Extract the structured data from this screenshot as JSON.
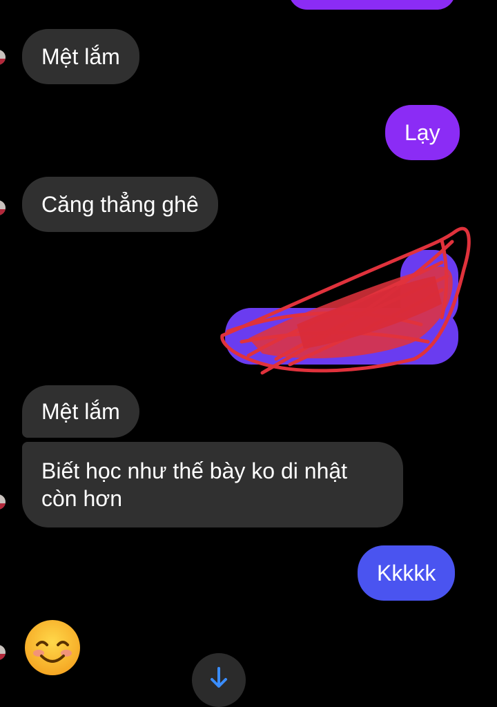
{
  "messages": [
    {
      "id": "m1",
      "direction": "outgoing",
      "text": ""
    },
    {
      "id": "m2",
      "direction": "incoming",
      "text": "Mệt lắm"
    },
    {
      "id": "m3",
      "direction": "outgoing",
      "text": "Lạy"
    },
    {
      "id": "m4",
      "direction": "incoming",
      "text": "Căng thẳng ghê"
    },
    {
      "id": "m5",
      "direction": "outgoing",
      "text": "",
      "redacted": true
    },
    {
      "id": "m6",
      "direction": "incoming",
      "text": "Mệt lắm"
    },
    {
      "id": "m7",
      "direction": "incoming",
      "text": "Biết học như thế bày ko di nhật còn hơn"
    },
    {
      "id": "m8",
      "direction": "outgoing",
      "text": "Kkkkk"
    },
    {
      "id": "m9",
      "direction": "incoming",
      "emoji": "smiling-face-with-smiling-eyes"
    }
  ],
  "colors": {
    "background": "#000000",
    "incoming_bubble": "#303030",
    "outgoing_purple": "#8b2cf5",
    "outgoing_violet": "#6a3cf0",
    "outgoing_blue": "#4a54f0",
    "scribble": "#e0323c"
  },
  "controls": {
    "scroll_down_icon": "arrow-down-icon"
  }
}
